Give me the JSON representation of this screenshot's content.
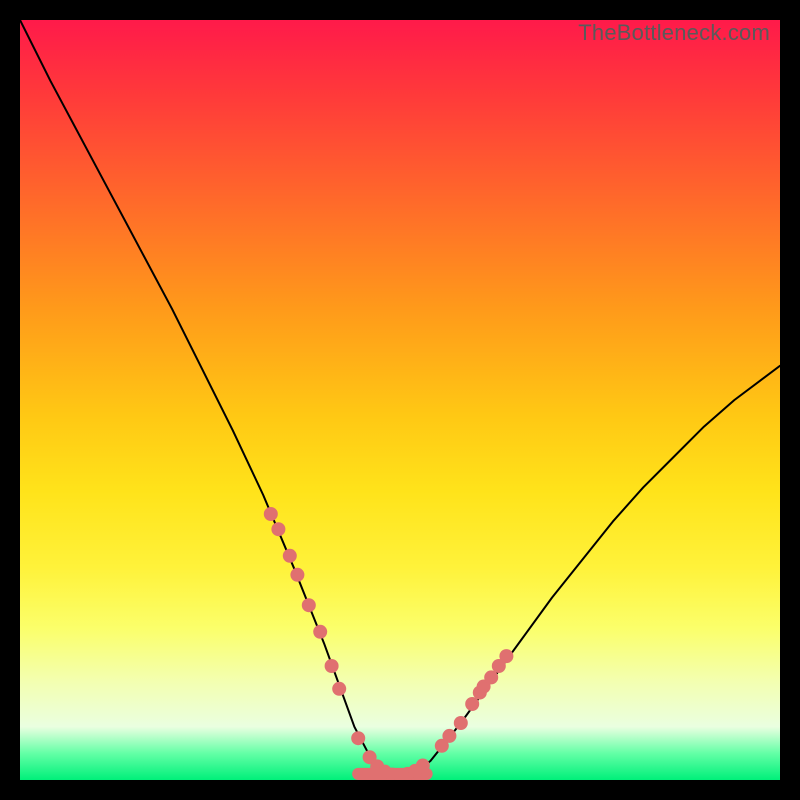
{
  "watermark": "TheBottleneck.com",
  "chart_data": {
    "type": "line",
    "title": "",
    "xlabel": "",
    "ylabel": "",
    "xlim": [
      0,
      100
    ],
    "ylim": [
      0,
      100
    ],
    "curve": {
      "name": "bottleneck-curve",
      "x": [
        0,
        4,
        8,
        12,
        16,
        20,
        24,
        28,
        32,
        36,
        38,
        40,
        42,
        44,
        46,
        48,
        50,
        52,
        54,
        58,
        62,
        66,
        70,
        74,
        78,
        82,
        86,
        90,
        94,
        98,
        100
      ],
      "y": [
        100,
        92,
        84.5,
        77,
        69.5,
        62,
        54,
        46,
        37.5,
        28,
        23,
        18,
        12.5,
        7,
        3.2,
        1.2,
        0.5,
        1.0,
        2.5,
        7.5,
        13,
        18.5,
        24,
        29,
        34,
        38.5,
        42.5,
        46.5,
        50,
        53,
        54.5
      ]
    },
    "marker_clusters": [
      {
        "name": "left-descent-markers",
        "color": "#e07070",
        "points": [
          {
            "x": 33.0,
            "y": 35.0
          },
          {
            "x": 34.0,
            "y": 33.0
          },
          {
            "x": 35.5,
            "y": 29.5
          },
          {
            "x": 36.5,
            "y": 27.0
          },
          {
            "x": 38.0,
            "y": 23.0
          },
          {
            "x": 39.5,
            "y": 19.5
          },
          {
            "x": 41.0,
            "y": 15.0
          },
          {
            "x": 42.0,
            "y": 12.0
          }
        ]
      },
      {
        "name": "right-ascent-markers",
        "color": "#e07070",
        "points": [
          {
            "x": 55.5,
            "y": 4.5
          },
          {
            "x": 56.5,
            "y": 5.8
          },
          {
            "x": 58.0,
            "y": 7.5
          },
          {
            "x": 59.5,
            "y": 10.0
          },
          {
            "x": 60.5,
            "y": 11.5
          },
          {
            "x": 61.0,
            "y": 12.3
          },
          {
            "x": 62.0,
            "y": 13.5
          },
          {
            "x": 63.0,
            "y": 15.0
          },
          {
            "x": 64.0,
            "y": 16.3
          }
        ]
      },
      {
        "name": "trough-markers",
        "color": "#e07070",
        "points": [
          {
            "x": 44.5,
            "y": 5.5
          },
          {
            "x": 46.0,
            "y": 3.0
          },
          {
            "x": 47.0,
            "y": 1.8
          },
          {
            "x": 48.0,
            "y": 1.1
          },
          {
            "x": 49.0,
            "y": 0.7
          },
          {
            "x": 50.0,
            "y": 0.6
          },
          {
            "x": 51.0,
            "y": 0.8
          },
          {
            "x": 52.0,
            "y": 1.2
          },
          {
            "x": 53.0,
            "y": 1.9
          }
        ]
      }
    ],
    "trough_bar": {
      "name": "trough-connector",
      "color": "#e07070",
      "x_start": 44.5,
      "x_end": 53.5,
      "y": 0.8,
      "thickness": 1.6
    }
  }
}
